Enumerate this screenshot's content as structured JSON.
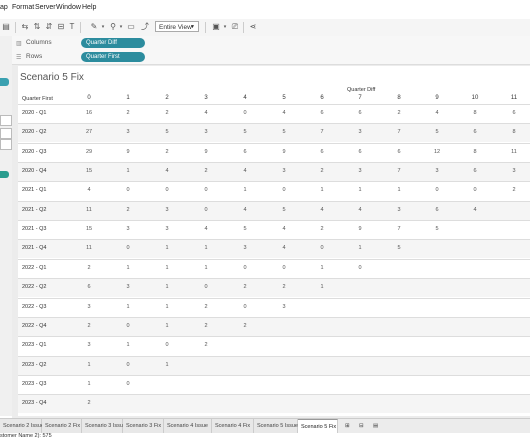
{
  "menu": {
    "items": [
      "ap",
      "Format",
      "Server",
      "Window",
      "Help"
    ]
  },
  "toolbar": {
    "fit_value": "Entire View"
  },
  "shelves": {
    "columns": {
      "label": "Columns",
      "pill": "Quarter Diff"
    },
    "rows": {
      "label": "Rows",
      "pill": "Quarter First"
    }
  },
  "view": {
    "title": "Scenario 5 Fix",
    "col_dim_title": "Quarter Diff",
    "row_dim_title": "Quarter First",
    "columns": [
      "0",
      "1",
      "2",
      "3",
      "4",
      "5",
      "6",
      "7",
      "8",
      "9",
      "10",
      "11"
    ],
    "rows": [
      {
        "label": "2020 - Q1",
        "values": [
          "16",
          "2",
          "2",
          "4",
          "0",
          "4",
          "6",
          "6",
          "2",
          "4",
          "8",
          "6"
        ]
      },
      {
        "label": "2020 - Q2",
        "values": [
          "27",
          "3",
          "5",
          "3",
          "5",
          "5",
          "7",
          "3",
          "7",
          "5",
          "6",
          "8"
        ]
      },
      {
        "label": "2020 - Q3",
        "values": [
          "29",
          "9",
          "2",
          "9",
          "6",
          "9",
          "6",
          "6",
          "6",
          "12",
          "8",
          "11"
        ]
      },
      {
        "label": "2020 - Q4",
        "values": [
          "15",
          "1",
          "4",
          "2",
          "4",
          "3",
          "2",
          "3",
          "7",
          "3",
          "6",
          "3"
        ]
      },
      {
        "label": "2021 - Q1",
        "values": [
          "4",
          "0",
          "0",
          "0",
          "1",
          "0",
          "1",
          "1",
          "1",
          "0",
          "0",
          "2"
        ]
      },
      {
        "label": "2021 - Q2",
        "values": [
          "11",
          "2",
          "3",
          "0",
          "4",
          "5",
          "4",
          "4",
          "3",
          "6",
          "4",
          ""
        ]
      },
      {
        "label": "2021 - Q3",
        "values": [
          "15",
          "3",
          "3",
          "4",
          "5",
          "4",
          "2",
          "9",
          "7",
          "5",
          "",
          ""
        ]
      },
      {
        "label": "2021 - Q4",
        "values": [
          "11",
          "0",
          "1",
          "1",
          "3",
          "4",
          "0",
          "1",
          "5",
          "",
          "",
          ""
        ]
      },
      {
        "label": "2022 - Q1",
        "values": [
          "2",
          "1",
          "1",
          "1",
          "0",
          "0",
          "1",
          "0",
          "",
          "",
          "",
          ""
        ]
      },
      {
        "label": "2022 - Q2",
        "values": [
          "6",
          "3",
          "1",
          "0",
          "2",
          "2",
          "1",
          "",
          "",
          "",
          "",
          ""
        ]
      },
      {
        "label": "2022 - Q3",
        "values": [
          "3",
          "1",
          "1",
          "2",
          "0",
          "3",
          "",
          "",
          "",
          "",
          "",
          ""
        ]
      },
      {
        "label": "2022 - Q4",
        "values": [
          "2",
          "0",
          "1",
          "2",
          "2",
          "",
          "",
          "",
          "",
          "",
          "",
          ""
        ]
      },
      {
        "label": "2023 - Q1",
        "values": [
          "3",
          "1",
          "0",
          "2",
          "",
          "",
          "",
          "",
          "",
          "",
          "",
          ""
        ]
      },
      {
        "label": "2023 - Q2",
        "values": [
          "1",
          "0",
          "1",
          "",
          "",
          "",
          "",
          "",
          "",
          "",
          "",
          ""
        ]
      },
      {
        "label": "2023 - Q3",
        "values": [
          "1",
          "0",
          "",
          "",
          "",
          "",
          "",
          "",
          "",
          "",
          "",
          ""
        ]
      },
      {
        "label": "2023 - Q4",
        "values": [
          "2",
          "",
          "",
          "",
          "",
          "",
          "",
          "",
          "",
          "",
          "",
          ""
        ]
      }
    ]
  },
  "tabs": [
    {
      "label": "Scenario 2 Issue"
    },
    {
      "label": "Scenario 2 Fix"
    },
    {
      "label": "Scenario 3 Issue"
    },
    {
      "label": "Scenario 3 Fix"
    },
    {
      "label": "Scenario 4 Issue"
    },
    {
      "label": "Scenario 4 Fix"
    },
    {
      "label": "Scenario 5 Issue"
    },
    {
      "label": "Scenario 5 Fix",
      "active": true
    }
  ],
  "status": {
    "text": "stomer Name 2): 575"
  },
  "colors": {
    "pill": "#2c8c9e",
    "band": "#f5f5f5",
    "sidebar_green": "#2a9d8f"
  }
}
